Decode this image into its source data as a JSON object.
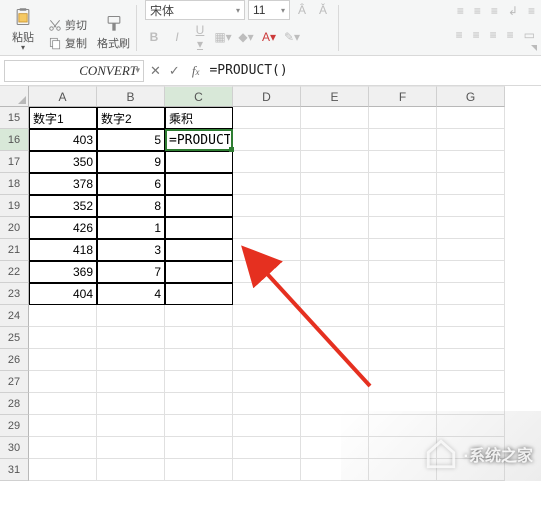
{
  "ribbon": {
    "paste_label": "粘贴",
    "cut_label": "剪切",
    "copy_label": "复制",
    "format_painter_label": "格式刷",
    "font_name": "宋体",
    "font_size": "11"
  },
  "namebox": {
    "value": "CONVERT"
  },
  "formula_bar": {
    "value": "=PRODUCT()"
  },
  "columns": [
    "A",
    "B",
    "C",
    "D",
    "E",
    "F",
    "G"
  ],
  "rows": [
    "15",
    "16",
    "17",
    "18",
    "19",
    "20",
    "21",
    "22",
    "23",
    "24",
    "25",
    "26",
    "27",
    "28",
    "29",
    "30",
    "31"
  ],
  "headers": {
    "a": "数字1",
    "b": "数字2",
    "c": "乘积"
  },
  "table": [
    {
      "a": "403",
      "b": "5"
    },
    {
      "a": "350",
      "b": "9"
    },
    {
      "a": "378",
      "b": "6"
    },
    {
      "a": "352",
      "b": "8"
    },
    {
      "a": "426",
      "b": "1"
    },
    {
      "a": "418",
      "b": "3"
    },
    {
      "a": "369",
      "b": "7"
    },
    {
      "a": "404",
      "b": "4"
    }
  ],
  "editing_cell": {
    "text": "=PRODUCT()"
  },
  "watermark": {
    "text": "·系统之家"
  }
}
